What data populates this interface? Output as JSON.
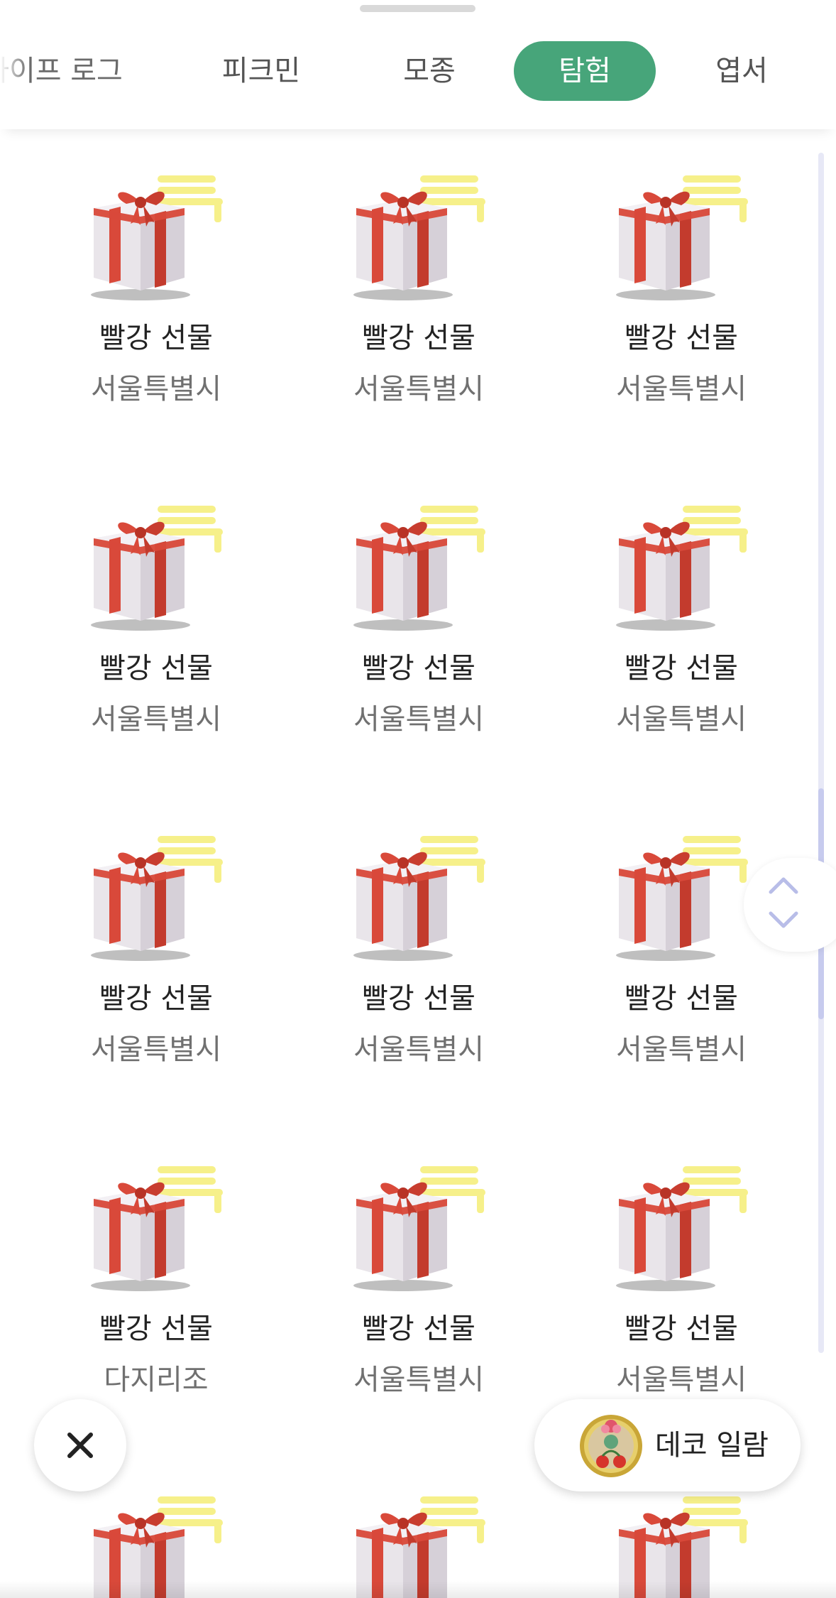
{
  "tabs": [
    {
      "label": "라이프 로그",
      "active": false
    },
    {
      "label": "피크민",
      "active": false
    },
    {
      "label": "모종",
      "active": false
    },
    {
      "label": "탐험",
      "active": true
    },
    {
      "label": "엽서",
      "active": false
    }
  ],
  "items": [
    {
      "name": "빨강 선물",
      "location": "서울특별시"
    },
    {
      "name": "빨강 선물",
      "location": "서울특별시"
    },
    {
      "name": "빨강 선물",
      "location": "서울특별시"
    },
    {
      "name": "빨강 선물",
      "location": "서울특별시"
    },
    {
      "name": "빨강 선물",
      "location": "서울특별시"
    },
    {
      "name": "빨강 선물",
      "location": "서울특별시"
    },
    {
      "name": "빨강 선물",
      "location": "서울특별시"
    },
    {
      "name": "빨강 선물",
      "location": "서울특별시"
    },
    {
      "name": "빨강 선물",
      "location": "서울특별시"
    },
    {
      "name": "빨강 선물",
      "location": "다지리조"
    },
    {
      "name": "빨강 선물",
      "location": "서울특별시"
    },
    {
      "name": "빨강 선물",
      "location": "서울특별시"
    }
  ],
  "floating": {
    "close_icon": "close-icon",
    "deco_label": "데코 일람",
    "deco_icon": "deco-badge-icon"
  },
  "colors": {
    "accent": "#47a57a",
    "ribbon": "#d9493a",
    "box": "#e9e5ea",
    "sticker": "#f6f08a",
    "scrollbar_track": "#e7e8f6",
    "scrollbar_thumb": "#c7cbee"
  }
}
